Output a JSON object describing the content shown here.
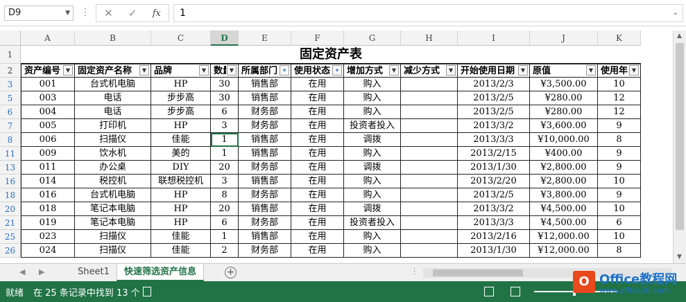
{
  "formula_bar": {
    "name_box": "D9",
    "formula": "1",
    "cancel_icon": "✕",
    "enter_icon": "✓",
    "fx_label": "fx"
  },
  "columns": [
    "A",
    "B",
    "C",
    "D",
    "E",
    "F",
    "G",
    "H",
    "I",
    "J",
    "K"
  ],
  "selected_column": "D",
  "title": "固定资产表",
  "headers": [
    "资产编号",
    "固定资产名称",
    "品牌",
    "数量",
    "所属部门",
    "使用状态",
    "增加方式",
    "减少方式",
    "开始使用日期",
    "原值",
    "使用年限"
  ],
  "header_display": [
    "资产编号",
    "固定资产名称",
    "品牌",
    "数量",
    "所属部门",
    "使用状态",
    "增加方式",
    "减少方式",
    "开始使用日期",
    "原值",
    "使用年限"
  ],
  "filtered_columns": [
    "E",
    "F"
  ],
  "rows": [
    {
      "num": "3",
      "cells": [
        "001",
        "台式机电脑",
        "HP",
        "30",
        "销售部",
        "在用",
        "购入",
        "",
        "2013/2/3",
        "¥3,500.00",
        "10"
      ]
    },
    {
      "num": "5",
      "cells": [
        "003",
        "电话",
        "步步高",
        "30",
        "销售部",
        "在用",
        "购入",
        "",
        "2013/2/5",
        "¥280.00",
        "12"
      ]
    },
    {
      "num": "6",
      "cells": [
        "004",
        "电话",
        "步步高",
        "6",
        "财务部",
        "在用",
        "购入",
        "",
        "2013/2/5",
        "¥280.00",
        "12"
      ]
    },
    {
      "num": "7",
      "cells": [
        "005",
        "打印机",
        "HP",
        "3",
        "财务部",
        "在用",
        "投资者投入",
        "",
        "2013/3/2",
        "¥3,600.00",
        "9"
      ]
    },
    {
      "num": "8",
      "cells": [
        "006",
        "扫描仪",
        "佳能",
        "1",
        "销售部",
        "在用",
        "调拨",
        "",
        "2013/3/3",
        "¥10,000.00",
        "8"
      ]
    },
    {
      "num": "11",
      "cells": [
        "009",
        "饮水机",
        "美的",
        "1",
        "销售部",
        "在用",
        "购入",
        "",
        "2013/2/15",
        "¥400.00",
        "9"
      ]
    },
    {
      "num": "13",
      "cells": [
        "011",
        "办公桌",
        "DIY",
        "20",
        "财务部",
        "在用",
        "调拨",
        "",
        "2013/1/30",
        "¥2,800.00",
        "9"
      ]
    },
    {
      "num": "16",
      "cells": [
        "014",
        "税控机",
        "联想税控机",
        "3",
        "销售部",
        "在用",
        "购入",
        "",
        "2013/2/20",
        "¥2,800.00",
        "10"
      ]
    },
    {
      "num": "18",
      "cells": [
        "016",
        "台式机电脑",
        "HP",
        "8",
        "财务部",
        "在用",
        "购入",
        "",
        "2013/2/5",
        "¥3,800.00",
        "9"
      ]
    },
    {
      "num": "20",
      "cells": [
        "018",
        "笔记本电脑",
        "HP",
        "20",
        "销售部",
        "在用",
        "调拨",
        "",
        "2013/3/2",
        "¥4,500.00",
        "10"
      ]
    },
    {
      "num": "21",
      "cells": [
        "019",
        "笔记本电脑",
        "HP",
        "6",
        "财务部",
        "在用",
        "投资者投入",
        "",
        "2013/3/3",
        "¥4,500.00",
        "6"
      ]
    },
    {
      "num": "25",
      "cells": [
        "023",
        "扫描仪",
        "佳能",
        "1",
        "销售部",
        "在用",
        "购入",
        "",
        "2013/2/16",
        "¥12,000.00",
        "10"
      ]
    },
    {
      "num": "26",
      "cells": [
        "024",
        "扫描仪",
        "佳能",
        "2",
        "财务部",
        "在用",
        "购入",
        "",
        "2013/1/30",
        "¥12,000.00",
        "8"
      ]
    }
  ],
  "selected_cell": {
    "row": "8",
    "col": "D"
  },
  "sheet_tabs": [
    {
      "label": "Sheet1",
      "active": false
    },
    {
      "label": "快速筛选资产信息",
      "active": true
    }
  ],
  "add_sheet": "+",
  "status": {
    "ready": "就绪",
    "message": "在 25 条记录中找到 13 个"
  },
  "watermark": {
    "logo": "O",
    "brand": "Office教程网",
    "url": "www.office26.com"
  }
}
